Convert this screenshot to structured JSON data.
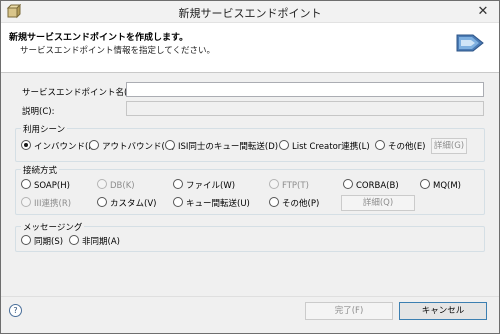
{
  "window": {
    "title": "新規サービスエンドポイント",
    "close_glyph": "✕"
  },
  "header": {
    "title": "新規サービスエンドポイントを作成します。",
    "description": "サービスエンドポイント情報を指定してください。"
  },
  "form": {
    "name_label": "サービスエンドポイント名(N)*:",
    "name_value": "",
    "desc_label": "説明(C):",
    "desc_value": ""
  },
  "usage_scene": {
    "title": "利用シーン",
    "options": [
      {
        "label": "インバウンド(I)",
        "checked": true,
        "disabled": false
      },
      {
        "label": "アウトバウンド(O)",
        "checked": false,
        "disabled": false
      },
      {
        "label": "ISI同士のキュー間転送(D)",
        "checked": false,
        "disabled": false
      },
      {
        "label": "List Creator連携(L)",
        "checked": false,
        "disabled": false
      },
      {
        "label": "その他(E)",
        "checked": false,
        "disabled": false
      }
    ],
    "detail_button": "詳細(G)"
  },
  "connection": {
    "title": "接続方式",
    "options": [
      {
        "label": "SOAP(H)",
        "checked": false,
        "disabled": false
      },
      {
        "label": "DB(K)",
        "checked": false,
        "disabled": true
      },
      {
        "label": "ファイル(W)",
        "checked": false,
        "disabled": false
      },
      {
        "label": "FTP(T)",
        "checked": false,
        "disabled": true
      },
      {
        "label": "CORBA(B)",
        "checked": false,
        "disabled": false
      },
      {
        "label": "MQ(M)",
        "checked": false,
        "disabled": false
      },
      {
        "label": "III連携(R)",
        "checked": false,
        "disabled": true
      },
      {
        "label": "カスタム(V)",
        "checked": false,
        "disabled": false
      },
      {
        "label": "キュー間転送(U)",
        "checked": false,
        "disabled": false
      },
      {
        "label": "その他(P)",
        "checked": false,
        "disabled": false
      }
    ],
    "detail_button": "詳細(Q)"
  },
  "messaging": {
    "title": "メッセージング",
    "options": [
      {
        "label": "同期(S)",
        "checked": false,
        "disabled": false
      },
      {
        "label": "非同期(A)",
        "checked": false,
        "disabled": false
      }
    ]
  },
  "footer": {
    "help_glyph": "?",
    "finish_button": "完了(F)",
    "cancel_button": "キャンセル"
  }
}
